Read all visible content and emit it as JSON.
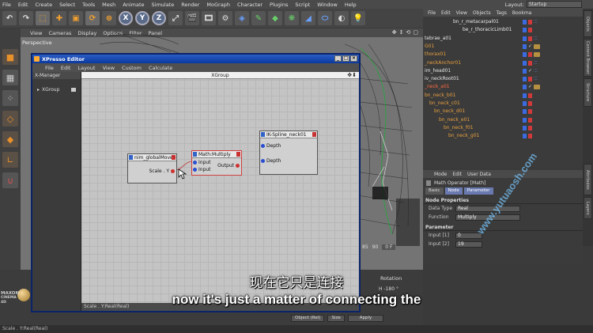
{
  "menubar": {
    "items": [
      "File",
      "Edit",
      "Create",
      "Select",
      "Tools",
      "Mesh",
      "Animate",
      "Simulate",
      "Render",
      "MoGraph",
      "Character",
      "Plugins",
      "Script",
      "Window",
      "Help"
    ],
    "layout_label": "Layout:",
    "layout_value": "Startup"
  },
  "toolbar": {
    "axis_x": "X",
    "axis_y": "Y",
    "axis_z": "Z"
  },
  "viewport": {
    "menu": [
      "View",
      "Cameras",
      "Display",
      "Options",
      "Filter",
      "Panel"
    ],
    "label": "Perspective"
  },
  "xpresso": {
    "title": "XPresso Editor",
    "menu": [
      "File",
      "Edit",
      "Layout",
      "View",
      "Custom",
      "Calculate"
    ],
    "xmanager_label": "X-Manager",
    "xgroup_item": "XGroup",
    "graph_title": "XGroup",
    "status": "Scale . Y:Real(Real)",
    "nodes": {
      "global_move": {
        "title": "nim_globalMove0",
        "port": "Scale . Y"
      },
      "math": {
        "title": "Math:Multiply",
        "in1": "Input",
        "in2": "Input",
        "out": "Output"
      },
      "ik": {
        "title": "IK-Spline_neck01",
        "p1": "Depth",
        "p2": "Depth"
      }
    }
  },
  "objects": {
    "menu": [
      "File",
      "Edit",
      "View",
      "Objects",
      "Tags",
      "Bookma"
    ],
    "rows": [
      {
        "name": "bn_r_metacarpal01",
        "color": "white"
      },
      {
        "name": "be_r_thoracicLimb01",
        "color": "white"
      },
      {
        "name": "tebrae_a01",
        "color": "white"
      },
      {
        "name": "G01",
        "color": "orange"
      },
      {
        "name": "thorax01",
        "color": "orange"
      },
      {
        "name": "_neckAnchor01",
        "color": "orange"
      },
      {
        "name": "im_head01",
        "color": "white"
      },
      {
        "name": "iv_neckRoot01",
        "color": "white"
      },
      {
        "name": "_neck_a01",
        "color": "red"
      },
      {
        "name": "bn_neck_b01",
        "color": "orange"
      },
      {
        "name": "bn_neck_c01",
        "color": "orange"
      },
      {
        "name": "bn_neck_d01",
        "color": "orange"
      },
      {
        "name": "bn_neck_e01",
        "color": "orange"
      },
      {
        "name": "bn_neck_f01",
        "color": "orange"
      },
      {
        "name": "bn_neck_g01",
        "color": "orange"
      }
    ]
  },
  "attributes": {
    "menu": [
      "Mode",
      "Edit",
      "User Data"
    ],
    "title": "Math Operator [Math]",
    "tabs": [
      "Basic",
      "Node",
      "Parameter"
    ],
    "section_node": "Node Properties",
    "data_type_label": "Data Type",
    "data_type_value": "Real",
    "function_label": "Function",
    "function_value": "Multiply",
    "section_param": "Parameter",
    "input1_label": "Input [1]",
    "input1_value": "0",
    "input2_label": "Input [2]",
    "input2_value": "19"
  },
  "sidetabs": [
    "Objects",
    "Content Browser",
    "Structure",
    "Attributes",
    "Layers"
  ],
  "timeline": {
    "n1": "85",
    "n2": "90",
    "frame": "0 F"
  },
  "coords": {
    "rotation": "Rotation",
    "h": "H  -180 °",
    "object": "Object (Rel)",
    "size": "Size",
    "apply": "Apply"
  },
  "brand": {
    "maxon": "MAXON",
    "cinema": "CINEMA 4D"
  },
  "statusbar": "Scale . Y:Real(Real)",
  "subtitles": {
    "cn": "现在它只是连接",
    "en": "now it's just a matter of connecting the"
  },
  "watermark": "www.yutuaosh.com"
}
